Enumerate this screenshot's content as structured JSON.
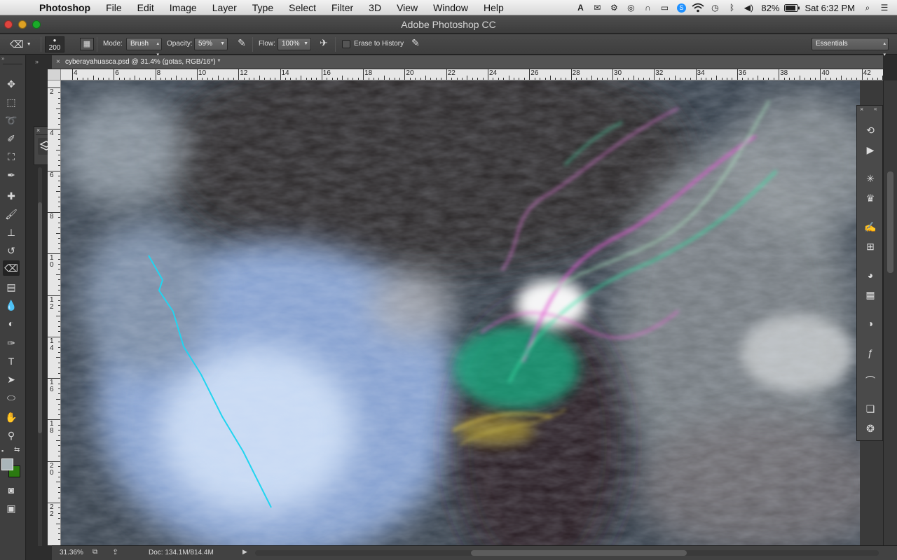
{
  "menubar": {
    "apple": "",
    "app": "Photoshop",
    "items": [
      "File",
      "Edit",
      "Image",
      "Layer",
      "Type",
      "Select",
      "Filter",
      "3D",
      "View",
      "Window",
      "Help"
    ],
    "battery": "82%",
    "clock": "Sat 6:32 PM"
  },
  "window": {
    "title": "Adobe Photoshop CC"
  },
  "options": {
    "brush_size": "200",
    "mode_label": "Mode:",
    "mode_value": "Brush",
    "opacity_label": "Opacity:",
    "opacity_value": "59%",
    "flow_label": "Flow:",
    "flow_value": "100%",
    "erase_history_label": "Erase to History",
    "workspace": "Essentials"
  },
  "document": {
    "tab_title": "cyberayahuasca.psd @ 31.4% (gotas, RGB/16*) *",
    "close": "×"
  },
  "ruler": {
    "h_labels": [
      "4",
      "6",
      "8",
      "10",
      "12",
      "14",
      "16",
      "18",
      "20",
      "22",
      "24",
      "26",
      "28",
      "30",
      "32",
      "34",
      "36",
      "38",
      "40",
      "42"
    ],
    "v_labels": [
      "2",
      "4",
      "6",
      "8",
      "1\n0",
      "1\n2",
      "1\n4",
      "1\n6",
      "1\n8",
      "2\n0",
      "2\n2"
    ]
  },
  "statusbar": {
    "zoom": "31.36%",
    "doc_info": "Doc: 134.1M/814.4M"
  },
  "colors": {
    "foreground": "#a9b5b9",
    "background": "#2b7a10",
    "ui_dark": "#3f3f3f"
  },
  "tools": [
    "move-tool-icon",
    "marquee-tool-icon",
    "lasso-tool-icon",
    "quick-select-tool-icon",
    "crop-tool-icon",
    "eyedropper-tool-icon",
    "healing-tool-icon",
    "brush-tool-icon",
    "stamp-tool-icon",
    "history-brush-tool-icon",
    "eraser-tool-icon",
    "gradient-tool-icon",
    "blur-tool-icon",
    "dodge-tool-icon",
    "pen-tool-icon",
    "type-tool-icon",
    "path-select-tool-icon",
    "shape-tool-icon",
    "hand-tool-icon",
    "zoom-tool-icon"
  ],
  "right_panel_icons": [
    "history-icon",
    "actions-icon",
    "3d-icon",
    "measurement-icon",
    "brushes-icon",
    "brush-presets-icon",
    "color-icon",
    "swatches-icon",
    "adjustments-icon",
    "styles-icon",
    "paths-icon",
    "layer-comps-icon",
    "channels-icon"
  ]
}
